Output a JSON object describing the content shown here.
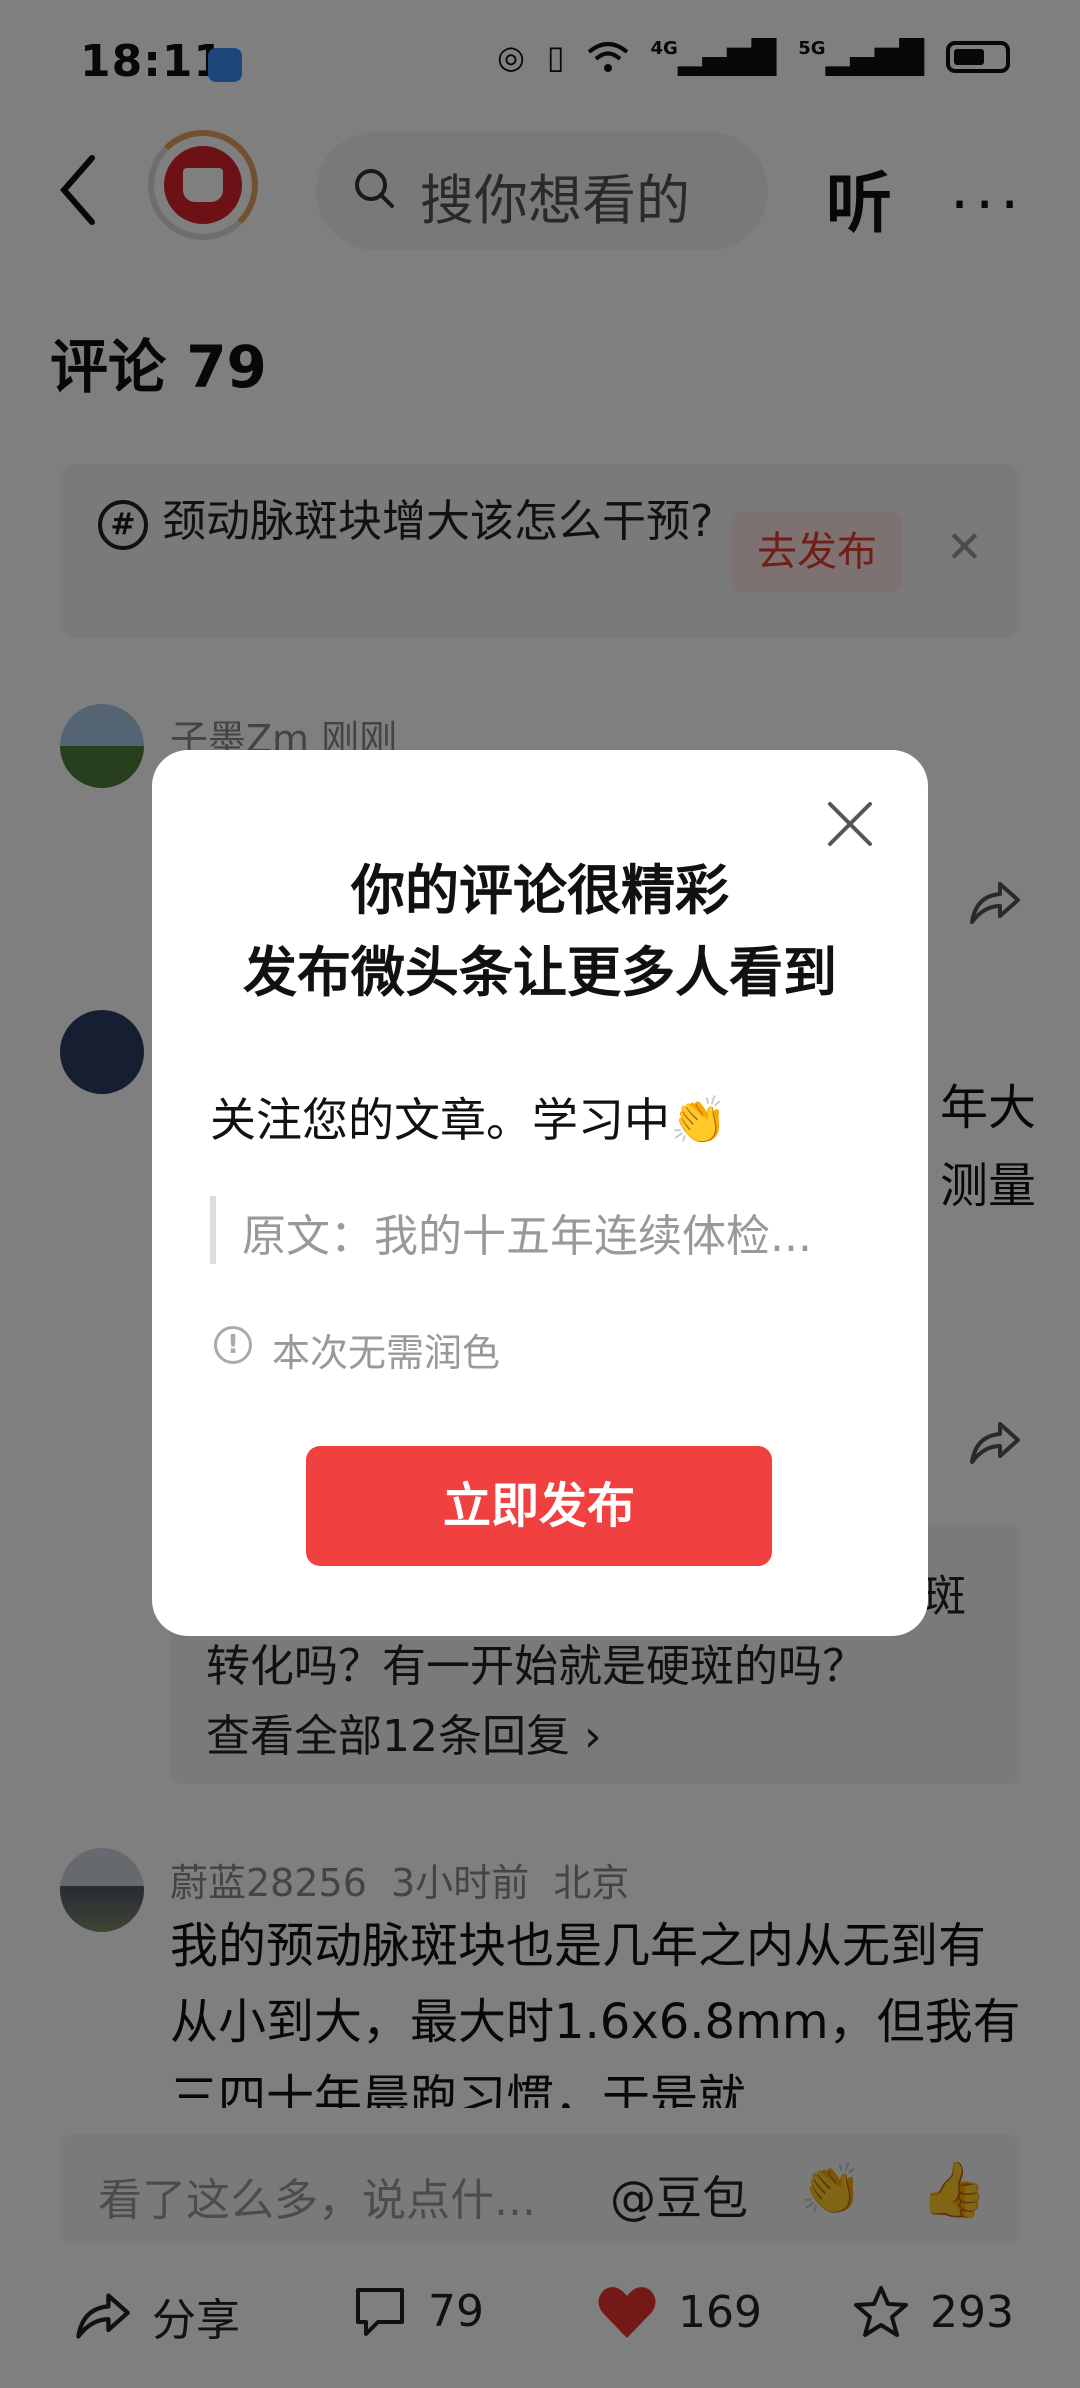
{
  "status_bar": {
    "time": "18:11",
    "network1": "4G",
    "network2": "5G"
  },
  "header": {
    "search_placeholder": "搜你想看的",
    "listen_label": "听",
    "more_label": "···"
  },
  "comments": {
    "title": "评论 79",
    "topic": {
      "text": "颈动脉斑块增大该怎么干预?",
      "button": "去发布"
    },
    "items": [
      {
        "user": "子墨Zm  刚刚"
      },
      {
        "user": "",
        "body_right1": "年大",
        "body_right2": "测量"
      },
      {
        "reply_preview_tail": "斑",
        "reply_line": "转化吗？有一开始就是硬斑的吗？",
        "reply_more": "查看全部12条回复 ›"
      },
      {
        "user": "蔚蓝28256  3小时前  北京",
        "body": "我的预动脉斑块也是几年之内从无到有从小到大，最大时1.6x6.8mm，但我有三四十年晨跑习惯，于是就"
      }
    ]
  },
  "input_bar": {
    "placeholder": "看了这么多，说点什...",
    "mention": "@豆包",
    "emoji1": "👏",
    "emoji2": "👍"
  },
  "bottom_bar": {
    "share": "分享",
    "comments": "79",
    "likes": "169",
    "favorites": "293"
  },
  "dialog": {
    "title_line1": "你的评论很精彩",
    "title_line2": "发布微头条让更多人看到",
    "comment": "关注您的文章。学习中👏",
    "quote": "原文：我的十五年连续体检...",
    "info": "本次无需润色",
    "button": "立即发布"
  }
}
